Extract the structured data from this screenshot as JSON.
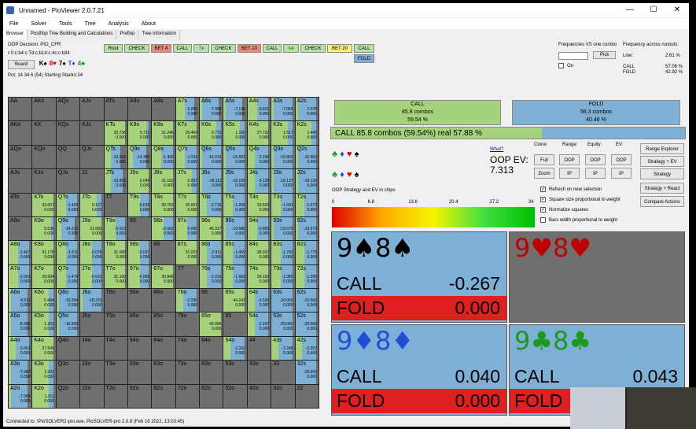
{
  "window": {
    "title": "Unnamed - PioViewer 2.0.7.21",
    "minimize": "—",
    "maximize": "☐",
    "close": "✕"
  },
  "menu": [
    "File",
    "Solver",
    "Tools",
    "Tree",
    "Analysis",
    "About"
  ],
  "tabs": [
    "Browser",
    "Postflop Tree Building and Calculations",
    "Preflop",
    "Tree information"
  ],
  "info": {
    "decision": "OOP Decision:  PIO_CFR",
    "line": "r:0:c:b4:c:Td:c:b14:c:4c:c:b34",
    "board_btn": "Board",
    "pot": "Pot: 14 34 6 (54) Starting Stacks:34",
    "board_cards": [
      "K♠",
      "8♥",
      "7♠",
      "T♦",
      "4♣"
    ]
  },
  "tree": {
    "row1": [
      "Root",
      "CHECK",
      "BET 4",
      "CALL",
      "T♦",
      "CHECK",
      "BET 10",
      "CALL",
      "4♣",
      "CHECK",
      "BET 20",
      "CALL"
    ],
    "row2": [
      "FOLD"
    ]
  },
  "freq": {
    "title_one": "Frequencies VS one combo",
    "title_across": "Frequency across runouts:",
    "pick": "Pick",
    "on": "On",
    "line_label": "Line:",
    "line_val": "2.61 %",
    "call_label": "CALL",
    "call_val": "57.06 %",
    "fold_label": "FOLD",
    "fold_val": "42.92 %"
  },
  "summary": {
    "call_name": "CALL",
    "call_combos": "85.8 combos",
    "call_pct": "59.54 %",
    "fold_name": "FOLD",
    "fold_combos": "58.3 combos",
    "fold_pct": "40.46 %",
    "bar": "CALL  85.8 combos (59.54%) real  57.88 %"
  },
  "ev": {
    "what": "What?",
    "label": "OOP EV:",
    "value": "7.313"
  },
  "ctrl": {
    "clone": "Clone:",
    "range": "Range:",
    "equity": "Equity:",
    "ev": "EV:",
    "full": "Full",
    "zoom": "Zoom",
    "oop1": "OOP",
    "ip1": "IP",
    "oop2": "OOP",
    "ip2": "IP",
    "oop3": "OOP",
    "ip3": "IP",
    "range_explorer": "Range Explorer",
    "strategy_ev": "Strategy + EV",
    "strategy": "Strategy",
    "strategy_react": "Strategy + React",
    "compare": "Compare Actions"
  },
  "checks": [
    {
      "label": "Refresh on new selection",
      "on": true
    },
    {
      "label": "Square size proportional to weight",
      "on": true
    },
    {
      "label": "Normalize squares",
      "on": true
    },
    {
      "label": "Bars width proportional to weight",
      "on": false
    }
  ],
  "legend": {
    "title": "OOP Strategy and EV in chips",
    "ticks": [
      "0",
      "6.8",
      "13.6",
      "20.4",
      "27.2",
      "34"
    ]
  },
  "combos": [
    {
      "name": "9♠8♠",
      "color": "#000000",
      "rows": [
        {
          "a": "CALL",
          "v": "-0.267"
        },
        {
          "a": "FOLD",
          "v": "0.000"
        }
      ],
      "call_frac": 1.0
    },
    {
      "name": "9♥8♥",
      "color": "#c00000",
      "rows": [],
      "call_frac": 0
    },
    {
      "name": "9♦8♦",
      "color": "#1f4fd8",
      "rows": [
        {
          "a": "CALL",
          "v": "0.040"
        },
        {
          "a": "FOLD",
          "v": "0.000"
        }
      ],
      "call_frac": 1.0
    },
    {
      "name": "9♣8♣",
      "color": "#1b9a1b",
      "rows": [
        {
          "a": "CALL",
          "v": "0.043"
        },
        {
          "a": "FOLD",
          "v": "0.000"
        }
      ],
      "call_frac": 1.0
    }
  ],
  "status": "Connected to .\\PioSOLVER2-pro.exe. PioSOLVER-pro 2.0.8 (Feb 16 2022, 13:03:45)",
  "grid": {
    "hands": [
      [
        "AA",
        "AKs",
        "AQs",
        "AJs",
        "ATs",
        "A9s",
        "A8s",
        "A7s",
        "A6s",
        "A5s",
        "A4s",
        "A3s",
        "A2s"
      ],
      [
        "AKo",
        "KK",
        "KQs",
        "KJs",
        "KTs",
        "K9s",
        "K8s",
        "K7s",
        "K6s",
        "K5s",
        "K4s",
        "K3s",
        "K2s"
      ],
      [
        "AQo",
        "KQo",
        "QQ",
        "QJs",
        "QTs",
        "Q9s",
        "Q8s",
        "Q7s",
        "Q6s",
        "Q5s",
        "Q4s",
        "Q3s",
        "Q2s"
      ],
      [
        "AJo",
        "KJo",
        "QJo",
        "JJ",
        "JTs",
        "J9s",
        "J8s",
        "J7s",
        "J6s",
        "J5s",
        "J4s",
        "J3s",
        "J2s"
      ],
      [
        "ATo",
        "KTo",
        "QTo",
        "JTo",
        "TT",
        "T9s",
        "T8s",
        "T7s",
        "T6s",
        "T5s",
        "T4s",
        "T3s",
        "T2s"
      ],
      [
        "A9o",
        "K9o",
        "Q9o",
        "J9o",
        "T9o",
        "99",
        "98s",
        "97s",
        "96s",
        "95s",
        "94s",
        "93s",
        "92s"
      ],
      [
        "A8o",
        "K8o",
        "Q8o",
        "J8o",
        "T8o",
        "98o",
        "88",
        "87s",
        "86s",
        "85s",
        "84s",
        "83s",
        "82s"
      ],
      [
        "A7o",
        "K7o",
        "Q7o",
        "J7o",
        "T7o",
        "97o",
        "87o",
        "77",
        "76s",
        "75s",
        "74s",
        "73s",
        "72s"
      ],
      [
        "A6o",
        "K6o",
        "Q6o",
        "J6o",
        "T6o",
        "96o",
        "86o",
        "76o",
        "66",
        "65s",
        "64s",
        "63s",
        "62s"
      ],
      [
        "A5o",
        "K5o",
        "Q5o",
        "J5o",
        "T5o",
        "95o",
        "85o",
        "75o",
        "65o",
        "55",
        "54s",
        "53s",
        "52s"
      ],
      [
        "A4o",
        "K4o",
        "Q4o",
        "J4o",
        "T4o",
        "94o",
        "84o",
        "74o",
        "64o",
        "54o",
        "44",
        "43s",
        "42s"
      ],
      [
        "A3o",
        "K3o",
        "Q3o",
        "J3o",
        "T3o",
        "93o",
        "83o",
        "73o",
        "63o",
        "53o",
        "43o",
        "33",
        "32s"
      ],
      [
        "A2o",
        "K2o",
        "Q2o",
        "J2o",
        "T2o",
        "92o",
        "82o",
        "72o",
        "62o",
        "52o",
        "42o",
        "32o",
        "22"
      ]
    ],
    "cells": [
      {
        "h": "A7s",
        "v1": "-3.099",
        "v2": "0.000",
        "call": 0.4,
        "fold": 0.4
      },
      {
        "h": "A6s",
        "v1": "-7.968",
        "v2": "0.000",
        "call": 0.1,
        "fold": 0.7
      },
      {
        "h": "A5s",
        "v1": "-7.136",
        "v2": "0.000",
        "call": 0.1,
        "fold": 0.7
      },
      {
        "h": "A4s",
        "v1": "-0.621",
        "v2": "0.000",
        "call": 0.4,
        "fold": 0.5
      },
      {
        "h": "A3s",
        "v1": "-7.059",
        "v2": "0.000",
        "call": 0.1,
        "fold": 0.8
      },
      {
        "h": "A2s",
        "v1": "-7.078",
        "v2": "0.000",
        "call": 0.1,
        "fold": 0.8
      },
      {
        "h": "KTs",
        "v1": "33.736",
        "v2": "0.000",
        "call": 0.9,
        "fold": 0
      },
      {
        "h": "K9s",
        "v1": "5.711",
        "v2": "0.000",
        "call": 0.8,
        "fold": 0.1
      },
      {
        "h": "K8s",
        "v1": "31.246",
        "v2": "0.000",
        "call": 0.9,
        "fold": 0
      },
      {
        "h": "K7s",
        "v1": "29.464",
        "v2": "0.000",
        "call": 0.9,
        "fold": 0
      },
      {
        "h": "K6s",
        "v1": "0.770",
        "v2": "0.000",
        "call": 0.7,
        "fold": 0.2
      },
      {
        "h": "K5s",
        "v1": "1.160",
        "v2": "0.000",
        "call": 0.7,
        "fold": 0.2
      },
      {
        "h": "K4s",
        "v1": "27.722",
        "v2": "0.000",
        "call": 0.9,
        "fold": 0
      },
      {
        "h": "K3s",
        "v1": "1.517",
        "v2": "0.000",
        "call": 0.7,
        "fold": 0.2
      },
      {
        "h": "K2s",
        "v1": "1.445",
        "v2": "0.000",
        "call": 0.7,
        "fold": 0.2
      },
      {
        "h": "QTs",
        "v1": "-13.624",
        "v2": "0.000",
        "call": 0.3,
        "fold": 0.4
      },
      {
        "h": "Q9s",
        "v1": "-14.390",
        "v2": "0.000",
        "call": 0.2,
        "fold": 0.6
      },
      {
        "h": "Q8s",
        "v1": "-1.490",
        "v2": "0.000",
        "call": 0.4,
        "fold": 0.5
      },
      {
        "h": "Q7s",
        "v1": "-1.511",
        "v2": "0.000",
        "call": 0.4,
        "fold": 0.5
      },
      {
        "h": "Q6s",
        "v1": "-16.012",
        "v2": "0.000",
        "call": 0.1,
        "fold": 0.8
      },
      {
        "h": "Q5s",
        "v1": "-16.692",
        "v2": "0.000",
        "call": 0.1,
        "fold": 0.8
      },
      {
        "h": "Q4s",
        "v1": "-2.190",
        "v2": "0.000",
        "call": 0.3,
        "fold": 0.6
      },
      {
        "h": "Q3s",
        "v1": "-15.952",
        "v2": "0.000",
        "call": 0.1,
        "fold": 0.8
      },
      {
        "h": "Q2s",
        "v1": "-15.952",
        "v2": "0.000",
        "call": 0.1,
        "fold": 0.8
      },
      {
        "h": "JTs",
        "v1": "-13.853",
        "v2": "0.000",
        "call": 0.3,
        "fold": 0.5
      },
      {
        "h": "J9s",
        "v1": "0.049",
        "v2": "0.000",
        "call": 0.9,
        "fold": 0
      },
      {
        "h": "J8s",
        "v1": "31.162",
        "v2": "0.000",
        "call": 0.9,
        "fold": 0
      },
      {
        "h": "J7s",
        "v1": "0.037",
        "v2": "0.000",
        "call": 0.7,
        "fold": 0.2
      },
      {
        "h": "J6s",
        "v1": "-18.111",
        "v2": "0.000",
        "call": 0.1,
        "fold": 0.8
      },
      {
        "h": "J5s",
        "v1": "-18.100",
        "v2": "0.000",
        "call": 0.1,
        "fold": 0.8
      },
      {
        "h": "J4s",
        "v1": "-3.128",
        "v2": "0.000",
        "call": 0.3,
        "fold": 0.6
      },
      {
        "h": "J3s",
        "v1": "-18.137",
        "v2": "0.000",
        "call": 0.1,
        "fold": 0.8
      },
      {
        "h": "J2s",
        "v1": "-18.130",
        "v2": "0.000",
        "call": 0.1,
        "fold": 0.8
      },
      {
        "h": "KTo",
        "v1": "33.657",
        "v2": "0.000",
        "call": 0.9,
        "fold": 0
      },
      {
        "h": "QTo",
        "v1": "-1.426",
        "v2": "0.000",
        "call": 0.4,
        "fold": 0.5
      },
      {
        "h": "JTo",
        "v1": "0.127",
        "v2": "0.000",
        "call": 0.7,
        "fold": 0.2
      },
      {
        "h": "T9s",
        "v1": "-0.015",
        "v2": "0.000",
        "call": 0.5,
        "fold": 0.4
      },
      {
        "h": "T8s",
        "v1": "30.752",
        "v2": "0.000",
        "call": 0.9,
        "fold": 0
      },
      {
        "h": "T7s",
        "v1": "30.657",
        "v2": "0.000",
        "call": 0.9,
        "fold": 0
      },
      {
        "h": "T6s",
        "v1": "-2.715",
        "v2": "0.000",
        "call": 0.3,
        "fold": 0.6
      },
      {
        "h": "T5s",
        "v1": "-1.266",
        "v2": "0.000",
        "call": 0.4,
        "fold": 0.5
      },
      {
        "h": "T4s",
        "v1": "29.529",
        "v2": "0.000",
        "call": 0.9,
        "fold": 0
      },
      {
        "h": "T3s",
        "v1": "-1.591",
        "v2": "0.000",
        "call": 0.4,
        "fold": 0.5
      },
      {
        "h": "T2s",
        "v1": "-1.573",
        "v2": "0.000",
        "call": 0.4,
        "fold": 0.5
      },
      {
        "h": "K9o",
        "v1": "5.536",
        "v2": "0.000",
        "call": 0.8,
        "fold": 0.1
      },
      {
        "h": "Q9o",
        "v1": "-14.375",
        "v2": "0.000",
        "call": 0.2,
        "fold": 0.6
      },
      {
        "h": "J9o",
        "v1": "31.082",
        "v2": "0.000",
        "call": 0.9,
        "fold": 0
      },
      {
        "h": "T9o",
        "v1": "-0.023",
        "v2": "0.000",
        "call": 0.5,
        "fold": 0.4
      },
      {
        "h": "98s",
        "v1": "-0.062",
        "v2": "0.000",
        "call": 0.5,
        "fold": 0.4
      },
      {
        "h": "97s",
        "v1": "0.000",
        "v2": "0.000",
        "call": 0.5,
        "fold": 0.4
      },
      {
        "h": "96s",
        "v1": "46.317",
        "v2": "0.000",
        "call": 0.9,
        "fold": 0
      },
      {
        "h": "95s",
        "v1": "-19.580",
        "v2": "0.000",
        "call": 0.1,
        "fold": 0.8
      },
      {
        "h": "94s",
        "v1": "-0.805",
        "v2": "0.000",
        "call": 0.4,
        "fold": 0.5
      },
      {
        "h": "93s",
        "v1": "-19.579",
        "v2": "0.000",
        "call": 0.1,
        "fold": 0.8
      },
      {
        "h": "92s",
        "v1": "-19.579",
        "v2": "0.000",
        "call": 0.1,
        "fold": 0.8
      },
      {
        "h": "A8o",
        "v1": "-2.467",
        "v2": "0.000",
        "call": 0.4,
        "fold": 0.5
      },
      {
        "h": "K8o",
        "v1": "31.178",
        "v2": "0.000",
        "call": 0.9,
        "fold": 0
      },
      {
        "h": "Q8o",
        "v1": "-1.511",
        "v2": "0.000",
        "call": 0.4,
        "fold": 0.5
      },
      {
        "h": "J8o",
        "v1": "-0.078",
        "v2": "0.000",
        "call": 0.5,
        "fold": 0.4
      },
      {
        "h": "T8o",
        "v1": "31.068",
        "v2": "0.000",
        "call": 0.9,
        "fold": 0
      },
      {
        "h": "98o",
        "v1": "-0.037",
        "v2": "0.000",
        "call": 0.5,
        "fold": 0.4
      },
      {
        "h": "87s",
        "v1": "31.023",
        "v2": "0.000",
        "call": 0.9,
        "fold": 0
      },
      {
        "h": "86s",
        "v1": "-2.911",
        "v2": "0.000",
        "call": 0.3,
        "fold": 0.6
      },
      {
        "h": "85s",
        "v1": "-1.469",
        "v2": "0.000",
        "call": 0.4,
        "fold": 0.5
      },
      {
        "h": "84s",
        "v1": "28.937",
        "v2": "0.000",
        "call": 0.9,
        "fold": 0
      },
      {
        "h": "83s",
        "v1": "-1.792",
        "v2": "0.000",
        "call": 0.4,
        "fold": 0.5
      },
      {
        "h": "82s",
        "v1": "-1.775",
        "v2": "0.000",
        "call": 0.4,
        "fold": 0.5
      },
      {
        "h": "A7o",
        "v1": "-2.052",
        "v2": "0.000",
        "call": 0.4,
        "fold": 0.5
      },
      {
        "h": "K7o",
        "v1": "29.584",
        "v2": "0.000",
        "call": 0.9,
        "fold": 0
      },
      {
        "h": "Q7o",
        "v1": "-1.478",
        "v2": "0.000",
        "call": 0.4,
        "fold": 0.5
      },
      {
        "h": "J7o",
        "v1": "-0.023",
        "v2": "0.000",
        "call": 0.5,
        "fold": 0.4
      },
      {
        "h": "T7o",
        "v1": "31.105",
        "v2": "0.000",
        "call": 0.9,
        "fold": 0
      },
      {
        "h": "97o",
        "v1": "-0.069",
        "v2": "0.000",
        "call": 0.5,
        "fold": 0.4
      },
      {
        "h": "87o",
        "v1": "30.848",
        "v2": "0.000",
        "call": 0.9,
        "fold": 0
      },
      {
        "h": "76s",
        "v1": "-2.016",
        "v2": "0.000",
        "call": 0.3,
        "fold": 0.6
      },
      {
        "h": "75s",
        "v1": "-1.669",
        "v2": "0.000",
        "call": 0.4,
        "fold": 0.5
      },
      {
        "h": "74s",
        "v1": "29.152",
        "v2": "0.000",
        "call": 0.9,
        "fold": 0
      },
      {
        "h": "73s",
        "v1": "-1.380",
        "v2": "0.000",
        "call": 0.4,
        "fold": 0.5
      },
      {
        "h": "72s",
        "v1": "-1.396",
        "v2": "0.000",
        "call": 0.4,
        "fold": 0.5
      },
      {
        "h": "A6o",
        "v1": "-8.611",
        "v2": "0.000",
        "call": 0.1,
        "fold": 0.7
      },
      {
        "h": "K6o",
        "v1": "0.484",
        "v2": "0.000",
        "call": 0.7,
        "fold": 0.2
      },
      {
        "h": "Q6o",
        "v1": "-16.364",
        "v2": "0.000",
        "call": 0.1,
        "fold": 0.8
      },
      {
        "h": "J6o",
        "v1": "-18.223",
        "v2": "0.000",
        "call": 0.1,
        "fold": 0.8
      },
      {
        "h": "76o",
        "v1": "-2.290",
        "v2": "0.000",
        "call": 0.3,
        "fold": 0.6
      },
      {
        "h": "65s",
        "v1": "44.242",
        "v2": "0.000",
        "call": 0.9,
        "fold": 0
      },
      {
        "h": "64s",
        "v1": "-3.530",
        "v2": "0.000",
        "call": 0.3,
        "fold": 0.6
      },
      {
        "h": "63s",
        "v1": "-20.000",
        "v2": "0.000",
        "call": 0,
        "fold": 0.9
      },
      {
        "h": "62s",
        "v1": "-20.000",
        "v2": "0.000",
        "call": 0,
        "fold": 0.9
      },
      {
        "h": "A5o",
        "v1": "-8.366",
        "v2": "0.000",
        "call": 0.1,
        "fold": 0.7
      },
      {
        "h": "K5o",
        "v1": "1.261",
        "v2": "0.000",
        "call": 0.7,
        "fold": 0.2
      },
      {
        "h": "Q5o",
        "v1": "-16.505",
        "v2": "0.000",
        "call": 0.1,
        "fold": 0.8
      },
      {
        "h": "65o",
        "v1": "43.996",
        "v2": "0.000",
        "call": 0.9,
        "fold": 0
      },
      {
        "h": "54s",
        "v1": "-2.107",
        "v2": "0.000",
        "call": 0.3,
        "fold": 0.6
      },
      {
        "h": "53s",
        "v1": "-20.000",
        "v2": "0.000",
        "call": 0,
        "fold": 0.9
      },
      {
        "h": "52s",
        "v1": "-20.000",
        "v2": "0.000",
        "call": 0,
        "fold": 0.9
      },
      {
        "h": "A4o",
        "v1": "-3.063",
        "v2": "0.000",
        "call": 0.3,
        "fold": 0.6
      },
      {
        "h": "K4o",
        "v1": "27.549",
        "v2": "0.000",
        "call": 0.9,
        "fold": 0
      },
      {
        "h": "54o",
        "v1": "-2.332",
        "v2": "0.000",
        "call": 0.3,
        "fold": 0.6
      },
      {
        "h": "43s",
        "v1": "-2.248",
        "v2": "0.000",
        "call": 0.3,
        "fold": 0.6
      },
      {
        "h": "42s",
        "v1": "-2.257",
        "v2": "0.000",
        "call": 0.3,
        "fold": 0.6
      },
      {
        "h": "A3o",
        "v1": "-7.987",
        "v2": "0.000",
        "call": 0.1,
        "fold": 0.7
      },
      {
        "h": "K3o",
        "v1": "1.291",
        "v2": "0.000",
        "call": 0.7,
        "fold": 0.2
      },
      {
        "h": "32s",
        "v1": "-20.000",
        "v2": "0.000",
        "call": 0,
        "fold": 0.9
      },
      {
        "h": "A2o",
        "v1": "-7.969",
        "v2": "0.000",
        "call": 0.1,
        "fold": 0.7
      },
      {
        "h": "K2o",
        "v1": "1.311",
        "v2": "0.000",
        "call": 0.7,
        "fold": 0.2
      }
    ]
  }
}
